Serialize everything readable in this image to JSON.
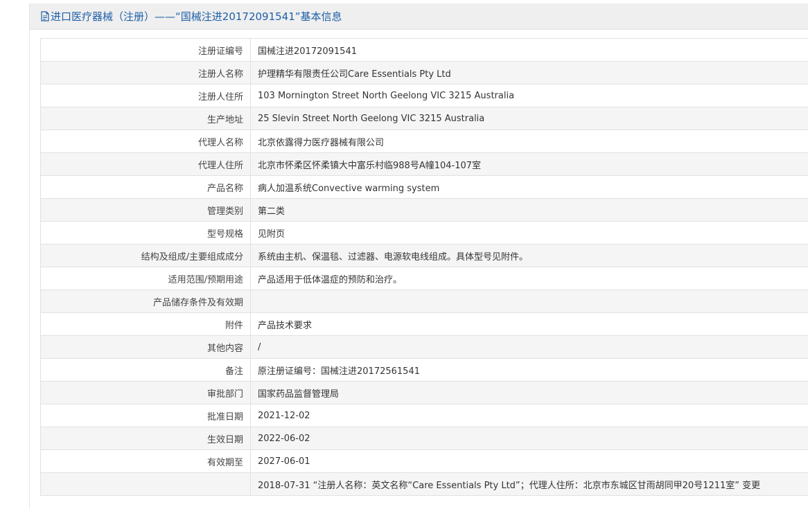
{
  "header": {
    "icon": "document-icon",
    "title": "进口医疗器械（注册）——“国械注进20172091541”基本信息"
  },
  "rows": [
    {
      "label": "注册证编号",
      "value": "国械注进20172091541"
    },
    {
      "label": "注册人名称",
      "value": "护理精华有限责任公司Care Essentials Pty Ltd"
    },
    {
      "label": "注册人住所",
      "value": "103 Mornington Street North Geelong VIC 3215 Australia"
    },
    {
      "label": "生产地址",
      "value": "25 Slevin Street North Geelong VIC 3215 Australia"
    },
    {
      "label": "代理人名称",
      "value": "北京依露得力医疗器械有限公司"
    },
    {
      "label": "代理人住所",
      "value": "北京市怀柔区怀柔镇大中富乐村临988号A幢104-107室"
    },
    {
      "label": "产品名称",
      "value": "病人加温系统Convective warming system"
    },
    {
      "label": "管理类别",
      "value": "第二类"
    },
    {
      "label": "型号规格",
      "value": "见附页"
    },
    {
      "label": "结构及组成/主要组成成分",
      "value": "系统由主机、保温毯、过滤器、电源软电线组成。具体型号见附件。"
    },
    {
      "label": "适用范围/预期用途",
      "value": "产品适用于低体温症的预防和治疗。"
    },
    {
      "label": "产品储存条件及有效期",
      "value": ""
    },
    {
      "label": "附件",
      "value": "产品技术要求"
    },
    {
      "label": "其他内容",
      "value": "/"
    },
    {
      "label": "备注",
      "value": "原注册证编号：国械注进20172561541"
    },
    {
      "label": "审批部门",
      "value": "国家药品监督管理局"
    },
    {
      "label": "批准日期",
      "value": "2021-12-02"
    },
    {
      "label": "生效日期",
      "value": "2022-06-02"
    },
    {
      "label": "有效期至",
      "value": "2027-06-01"
    },
    {
      "label": "",
      "value": "2018-07-31 “注册人名称：英文名称“Care Essentials Pty Ltd”；代理人住所：北京市东城区甘雨胡同甲20号1211室” 变更"
    }
  ],
  "colors": {
    "header_bg": "#efefef",
    "header_text": "#1e5fa8",
    "row_alt_bg": "#f5f5f5",
    "border": "#e1e1e1"
  }
}
